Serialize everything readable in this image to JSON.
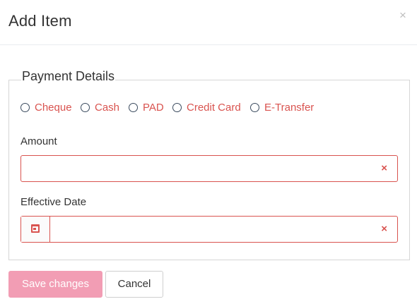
{
  "header": {
    "title": "Add Item",
    "close_glyph": "×"
  },
  "payment": {
    "legend": "Payment Details",
    "methods": [
      {
        "label": "Cheque",
        "selected": false
      },
      {
        "label": "Cash",
        "selected": false
      },
      {
        "label": "PAD",
        "selected": false
      },
      {
        "label": "Credit Card",
        "selected": false
      },
      {
        "label": "E-Transfer",
        "selected": false
      }
    ]
  },
  "amount": {
    "label": "Amount",
    "value": "",
    "clear_glyph": "×"
  },
  "effective_date": {
    "label": "Effective Date",
    "value": "",
    "clear_glyph": "×",
    "icon": "calendar-icon"
  },
  "footer": {
    "save_label": "Save changes",
    "cancel_label": "Cancel"
  },
  "colors": {
    "error": "#d9534f",
    "primary_disabled": "#f29db4"
  }
}
